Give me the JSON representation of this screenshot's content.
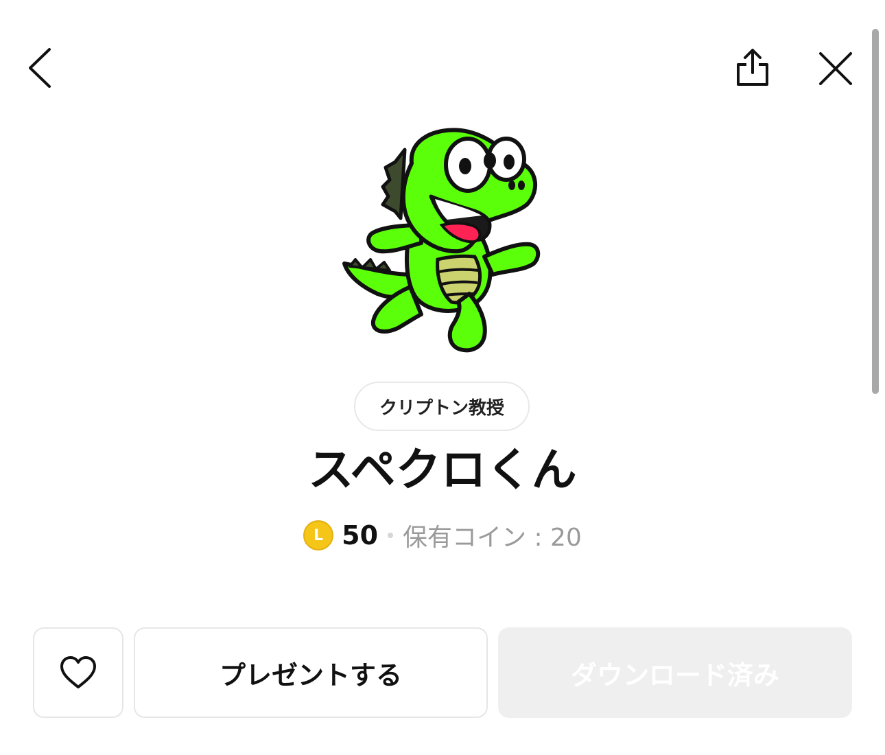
{
  "header": {
    "back_icon": "chevron-left-icon",
    "share_icon": "share-icon",
    "close_icon": "close-icon"
  },
  "sticker": {
    "image": "green-crocodile-character-running",
    "author": "クリプトン教授",
    "title": "スペクロくん"
  },
  "price": {
    "coin_letter": "L",
    "amount": "50",
    "owned_coins": "保有コイン : 20"
  },
  "actions": {
    "like_icon": "heart-icon",
    "gift_label": "プレゼントする",
    "download_label": "ダウンロード済み"
  },
  "colors": {
    "coin": "#f5c518",
    "disabled_bg": "#efefef",
    "muted_text": "#9a9a9a",
    "character_green": "#5cff0a"
  }
}
